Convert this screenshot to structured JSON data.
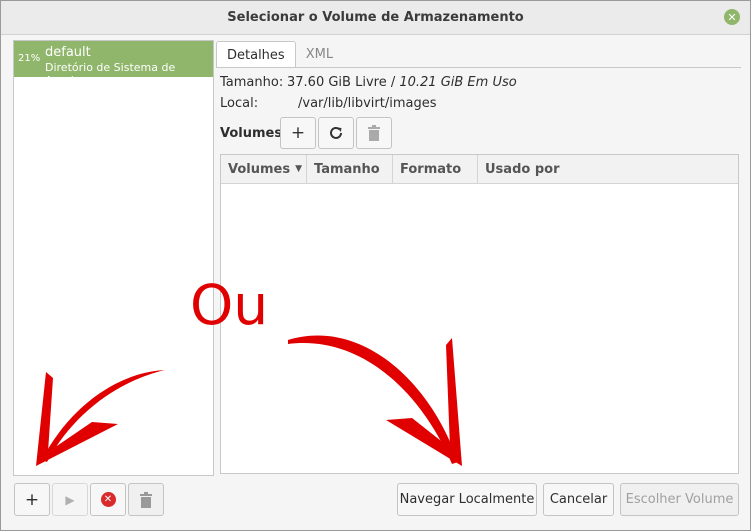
{
  "window": {
    "title": "Selecionar o Volume de Armazenamento",
    "close_icon": "close-icon"
  },
  "pools": [
    {
      "percent": "21%",
      "name": "default",
      "description": "Diretório de Sistema de Arquivo"
    }
  ],
  "tabs": [
    {
      "label": "Detalhes",
      "active": true
    },
    {
      "label": "XML",
      "active": false
    }
  ],
  "details": {
    "size_label": "Tamanho:",
    "size_free": "37.60 GiB Livre / ",
    "size_used": "10.21 GiB Em Uso",
    "location_label": "Local:",
    "location_value": "/var/lib/libvirt/images",
    "volumes_label": "Volumes"
  },
  "volume_toolbar": {
    "add_icon": "plus-icon",
    "refresh_icon": "refresh-icon",
    "delete_icon": "trash-icon"
  },
  "table": {
    "columns": [
      "Volumes",
      "Tamanho",
      "Formato",
      "Usado por"
    ],
    "sorted_column": "Volumes",
    "rows": []
  },
  "pool_toolbar": {
    "add_icon": "plus-icon",
    "start_icon": "play-icon",
    "stop_icon": "stop-icon",
    "delete_icon": "trash-icon"
  },
  "buttons": {
    "browse_local": "Navegar Localmente",
    "cancel": "Cancelar",
    "choose_volume": "Escolher Volume"
  },
  "annotation": {
    "text": "Ou",
    "color": "#e00000"
  },
  "colors": {
    "selection": "#8fb66a",
    "annotation": "#e00000"
  }
}
